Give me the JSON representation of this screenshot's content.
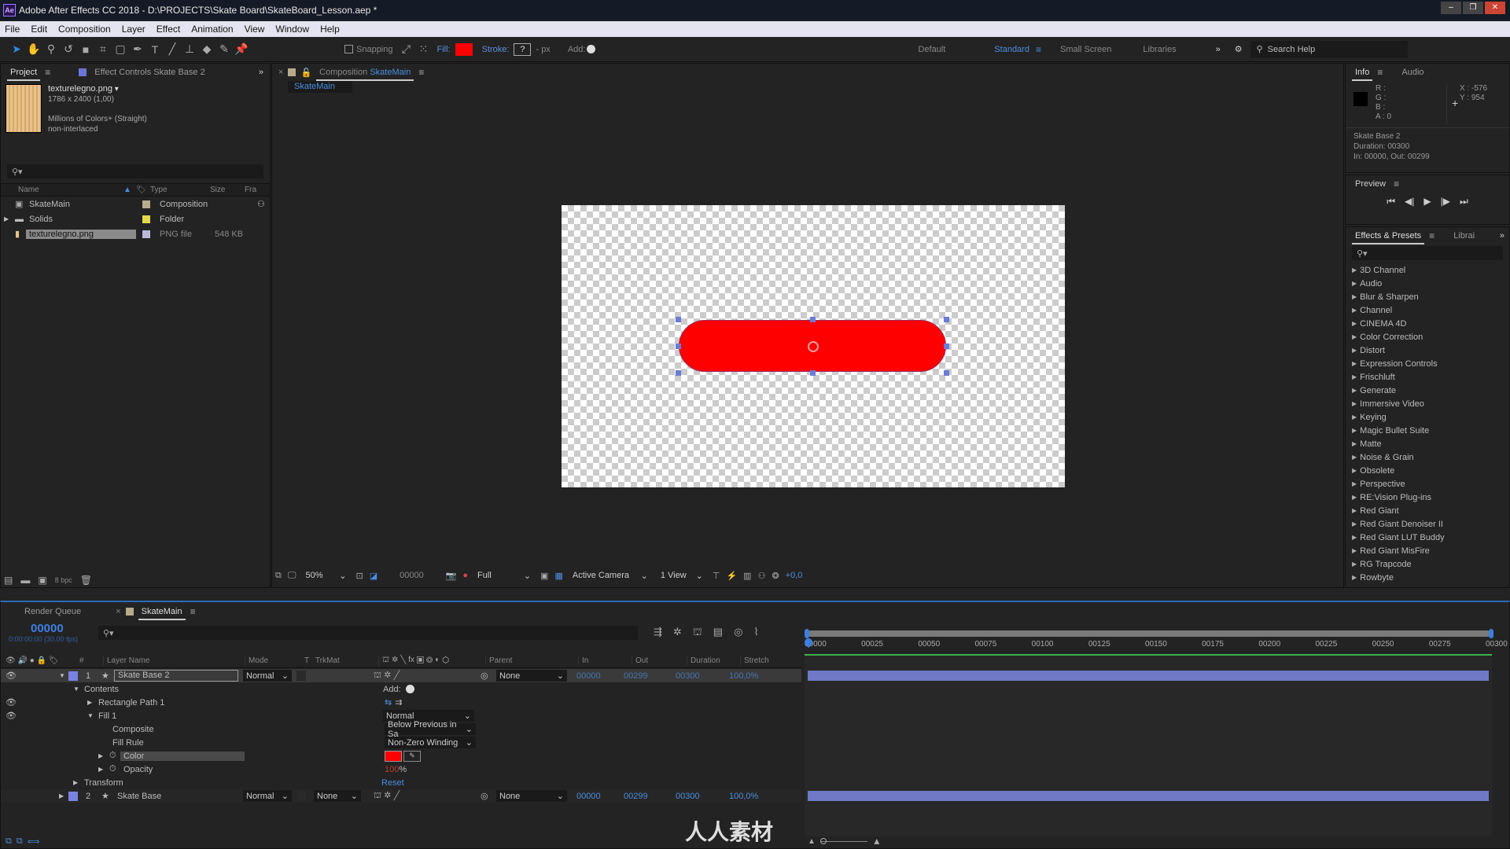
{
  "window": {
    "app_icon": "Ae",
    "title": "Adobe After Effects CC 2018 - D:\\PROJECTS\\Skate Board\\SkateBoard_Lesson.aep *",
    "controls": [
      "minimize",
      "maximize",
      "close"
    ]
  },
  "menu": [
    "File",
    "Edit",
    "Composition",
    "Layer",
    "Effect",
    "Animation",
    "View",
    "Window",
    "Help"
  ],
  "toolbar": {
    "tools": [
      "selection-tool",
      "hand-tool",
      "zoom-tool",
      "rotation-tool",
      "camera-tool",
      "pan-behind-tool",
      "rectangle-tool",
      "pen-tool",
      "type-tool",
      "brush-tool",
      "clone-stamp-tool",
      "eraser-tool",
      "roto-brush-tool",
      "puppet-pin-tool"
    ],
    "snapping_label": "Snapping",
    "fill_label": "Fill:",
    "fill_color": "#ff0000",
    "stroke_label": "Stroke:",
    "stroke_value": "?",
    "stroke_width": "- px",
    "add_label": "Add:",
    "workspaces": [
      "Default",
      "Standard",
      "Small Screen",
      "Libraries"
    ],
    "active_workspace": "Standard",
    "search_placeholder": "Search Help"
  },
  "project_panel": {
    "tab_project": "Project",
    "tab_effect_controls": "Effect Controls Skate Base 2",
    "preview": {
      "filename": "texturelegno.png",
      "dimensions": "1786 x 2400 (1,00)",
      "color_depth": "Millions of Colors+ (Straight)",
      "interlace": "non-interlaced"
    },
    "search_placeholder": "",
    "columns": [
      "Name",
      "Type",
      "Size",
      "Fra"
    ],
    "items": [
      {
        "name": "SkateMain",
        "type": "Composition",
        "size": "",
        "label_color": "#b6ab8b",
        "icon": "composition-icon"
      },
      {
        "name": "Solids",
        "type": "Folder",
        "size": "",
        "label_color": "#e3d84b",
        "icon": "folder-icon"
      },
      {
        "name": "texturelegno.png",
        "type": "PNG file",
        "size": "548 KB",
        "label_color": "#b9b9d6",
        "icon": "image-icon"
      }
    ],
    "bpc": "8 bpc"
  },
  "composition_panel": {
    "tab_prefix": "Composition",
    "tab_name": "SkateMain",
    "breadcrumb": "SkateMain",
    "shape_color": "#ff0000",
    "viewer": {
      "zoom": "50%",
      "timecode": "00000",
      "resolution": "Full",
      "camera": "Active Camera",
      "views": "1 View",
      "exposure": "+0,0"
    }
  },
  "info_panel": {
    "tab_info": "Info",
    "tab_audio": "Audio",
    "r_label": "R :",
    "g_label": "G :",
    "b_label": "B :",
    "a_label": "A :  0",
    "x": "X : -576",
    "y": "Y : 954",
    "layer_name": "Skate Base 2",
    "duration": "Duration: 00300",
    "in_out": "In: 00000, Out: 00299"
  },
  "preview_panel": {
    "title": "Preview",
    "controls": [
      "first-frame",
      "prev-frame",
      "play",
      "next-frame",
      "last-frame"
    ]
  },
  "effects_panel": {
    "tab_effects": "Effects & Presets",
    "tab_libraries": "Librai",
    "categories": [
      "3D Channel",
      "Audio",
      "Blur & Sharpen",
      "Channel",
      "CINEMA 4D",
      "Color Correction",
      "Distort",
      "Expression Controls",
      "Frischluft",
      "Generate",
      "Immersive Video",
      "Keying",
      "Magic Bullet Suite",
      "Matte",
      "Noise & Grain",
      "Obsolete",
      "Perspective",
      "RE:Vision Plug-ins",
      "Red Giant",
      "Red Giant Denoiser II",
      "Red Giant LUT Buddy",
      "Red Giant MisFire",
      "RG Trapcode",
      "Rowbyte"
    ]
  },
  "timeline": {
    "tab_render_queue": "Render Queue",
    "tab_comp": "SkateMain",
    "current_time": "00000",
    "fps_text": "0:00:00:00 (30.00 fps)",
    "columns": {
      "num": "#",
      "layer_name": "Layer Name",
      "mode": "Mode",
      "t": "T",
      "trkmat": "TrkMat",
      "parent": "Parent",
      "in": "In",
      "out": "Out",
      "duration": "Duration",
      "stretch": "Stretch"
    },
    "ruler": [
      "00000",
      "00025",
      "00050",
      "00075",
      "00100",
      "00125",
      "00150",
      "00175",
      "00200",
      "00225",
      "00250",
      "00275",
      "00300"
    ],
    "layers": [
      {
        "num": "1",
        "name": "Skate Base 2",
        "mode": "Normal",
        "trkmat": "",
        "parent": "None",
        "in": "00000",
        "out": "00299",
        "duration": "00300",
        "stretch": "100,0%",
        "color": "#7b83e0"
      },
      {
        "num": "2",
        "name": "Skate Base",
        "mode": "Normal",
        "trkmat": "None",
        "parent": "None",
        "in": "00000",
        "out": "00299",
        "duration": "00300",
        "stretch": "100,0%",
        "color": "#7b83e0"
      }
    ],
    "properties": {
      "contents": "Contents",
      "add_label": "Add:",
      "rect_path": "Rectangle Path 1",
      "fill": "Fill 1",
      "fill_mode": "Normal",
      "composite": "Composite",
      "composite_value": "Below Previous in Sa",
      "fill_rule": "Fill Rule",
      "fill_rule_value": "Non-Zero Winding",
      "color": "Color",
      "color_value": "#ff0000",
      "opacity": "Opacity",
      "opacity_value": "100",
      "opacity_unit": "%",
      "transform": "Transform",
      "transform_value": "Reset"
    }
  },
  "watermark": "人人素材"
}
